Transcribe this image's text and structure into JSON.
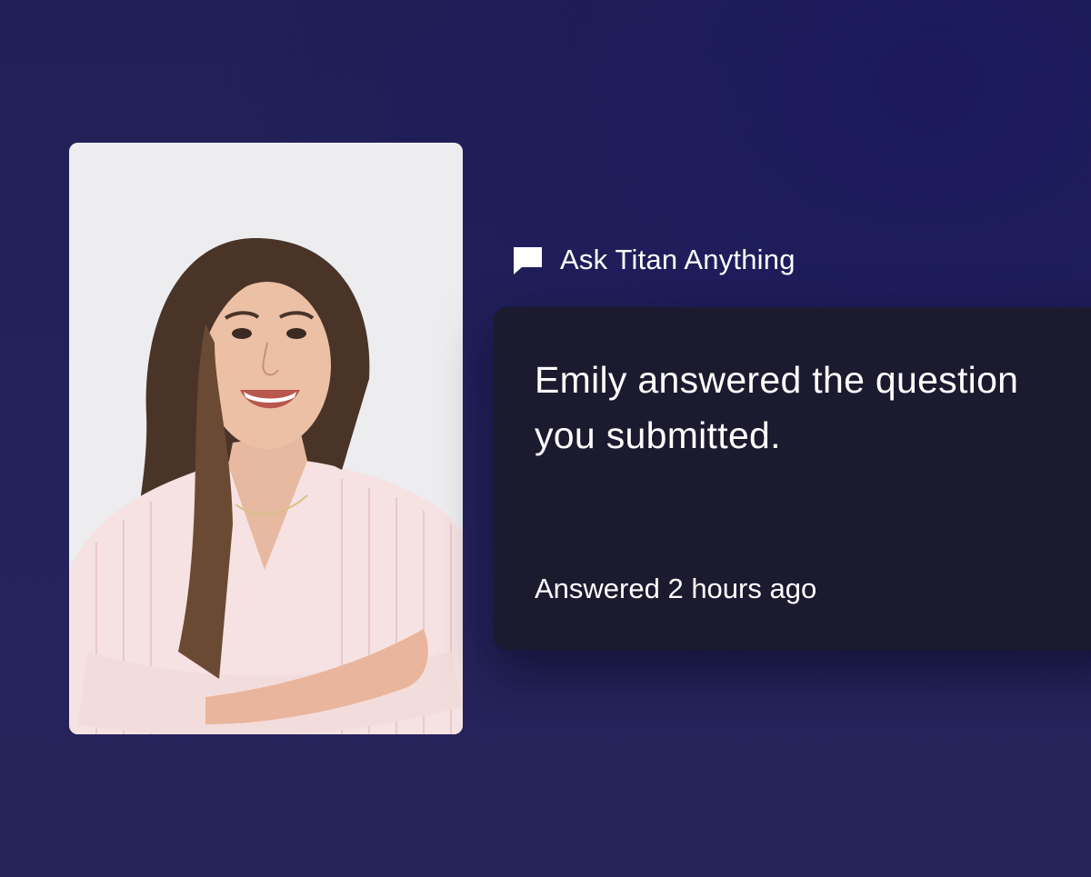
{
  "feature": {
    "label": "Ask Titan Anything",
    "icon": "chat-bubble-icon"
  },
  "notification": {
    "message": "Emily answered the question you submitted.",
    "time": "Answered 2 hours ago"
  },
  "colors": {
    "background": "#23215a",
    "card": "#1c1a2e",
    "text": "#ffffff"
  }
}
